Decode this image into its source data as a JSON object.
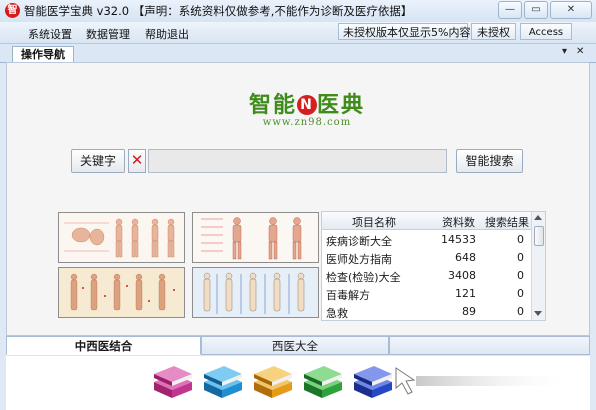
{
  "window": {
    "title": "智能医学宝典 v32.0 【声明：系统资料仅做参考,不能作为诊断及医疗依据】",
    "app_icon_glyph": "智",
    "controls": [
      "▭",
      "▭",
      "✕"
    ]
  },
  "menubar": {
    "items": [
      "系统设置",
      "数据管理",
      "帮助退出"
    ],
    "notice_button": "未授权版本仅显示5%内容",
    "auth_button": "未授权",
    "access_button": "Access"
  },
  "nav_tab": {
    "label": "操作导航",
    "dropdown_glyph": "▾",
    "close_glyph": "✕"
  },
  "logo": {
    "text": "智能",
    "badge": "N",
    "text2": "医典",
    "url": "www.zn98.com"
  },
  "search": {
    "keyword_button": "关键字",
    "clear_glyph": "✕",
    "input_value": "",
    "search_button": "智能搜索"
  },
  "table": {
    "headers": [
      "项目名称",
      "资料数",
      "搜索结果"
    ],
    "rows": [
      [
        "疾病诊断大全",
        "14533",
        "0"
      ],
      [
        "医师处方指南",
        "648",
        "0"
      ],
      [
        "检查(检验)大全",
        "3408",
        "0"
      ],
      [
        "百毒解方",
        "121",
        "0"
      ],
      [
        "急救",
        "89",
        "0"
      ]
    ]
  },
  "bottom_tabs": [
    "中西医结合",
    "西医大全",
    ""
  ],
  "colors": {
    "accent_red": "#d71a1a",
    "logo_green": "#3f8c1c",
    "frame_blue": "#dfe9f5",
    "book_colors": [
      "#c0368f",
      "#1f8fd1",
      "#e49b1a",
      "#2fa33b",
      "#2748c4"
    ]
  }
}
